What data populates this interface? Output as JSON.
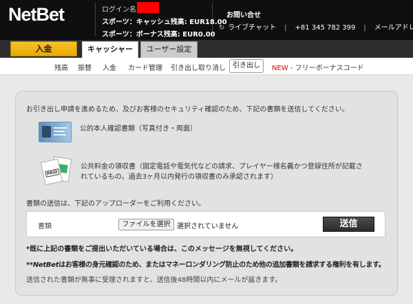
{
  "header": {
    "logo_net": "Net",
    "logo_bet": "Bet",
    "login_label": "ログイン名：",
    "cash_balance": "スポーツ：キャッシュ残高: EUR18.00",
    "bonus_balance": "スポーツ：ボーナス残高: EUR0.00",
    "contact_title": "お問い合せ",
    "live_chat": "ライブチャット",
    "phone": "+81 345 782 399",
    "email": "メールアドレス",
    "separator": "|"
  },
  "tabs": {
    "deposit": "入金",
    "cashier": "キャッシャー",
    "settings": "ユーザー設定"
  },
  "subnav": {
    "items": [
      "残高",
      "振替",
      "入金",
      "カード管理",
      "引き出し取り消し"
    ],
    "active": "引き出し",
    "new_badge": "NEW",
    "bonus_code": " - フリーボーナスコード"
  },
  "main": {
    "intro": "お引き出し申請を進めるため、及びお客様のセキュリティ確認のため、下記の書類を送信してください。",
    "doc1": "公的本人確認書類（写真付き・両面）",
    "doc2": "公共料金の領収書（固定電話や電気代などの請求、プレイヤー様名義かつ登録住所が記載されているもの。過去3ヶ月以内発行の領収書のみ承認されます）",
    "paid_label": "PAID",
    "uploader_note": "書類の送信は、下記のアップローダーをご利用ください。",
    "upload_label": "書類",
    "file_button": "ファイルを選択",
    "file_status": "選択されていません",
    "send_button": "送信",
    "note1": "*既に上記の書類をご提出いただいている場合は、このメッセージを無視してください。",
    "note2_prefix": "**",
    "note2_brand": "NetBet",
    "note2_rest": "はお客様の身元確認のため、またはマネーロンダリング防止のため他の追加書類を請求する権利を有します。",
    "note3": "送信された書類が無事に受理されますと、送信後48時間以内にメールが届きます。"
  },
  "colors": {
    "header_bg": "#0f0f0f",
    "deposit_yellow": "#f2b70f",
    "new_red": "#e00000",
    "redaction": "#ff0000"
  }
}
